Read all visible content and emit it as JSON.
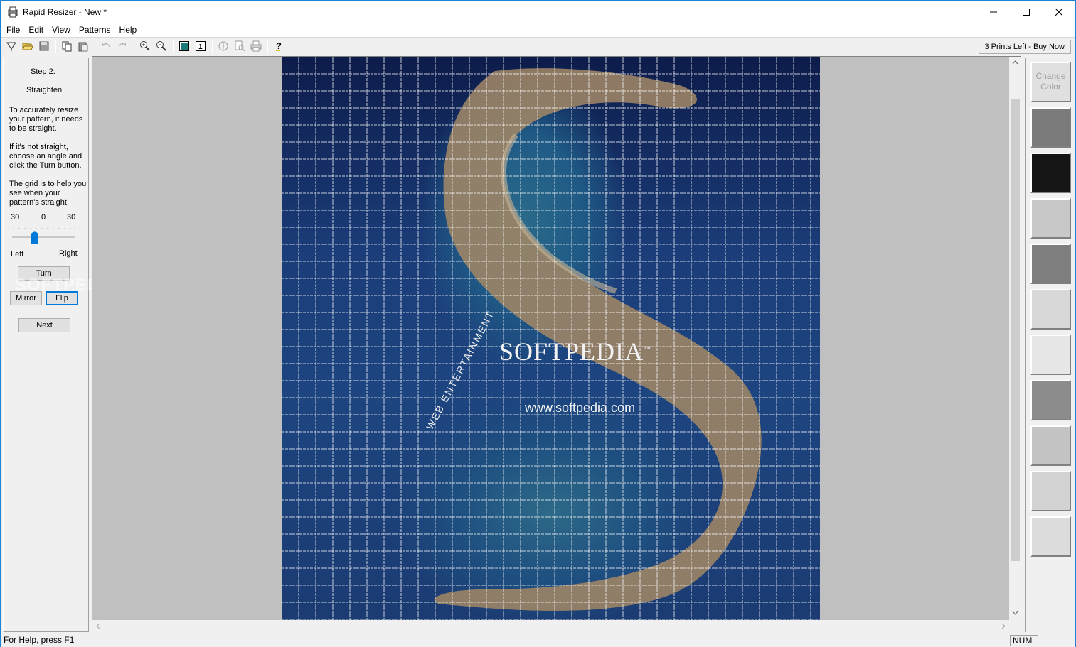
{
  "window": {
    "title": "Rapid Resizer - New *"
  },
  "menu": [
    "File",
    "Edit",
    "View",
    "Patterns",
    "Help"
  ],
  "toolbar": {
    "buttons": [
      "new-icon",
      "open-icon",
      "save-icon",
      "copy-icon",
      "paste-icon",
      "undo-icon",
      "redo-icon",
      "zoom-in-icon",
      "zoom-out-icon",
      "fit-page-icon",
      "actual-size-icon",
      "info-icon",
      "print-preview-icon",
      "print-icon",
      "help-icon"
    ],
    "buy_label": "3 Prints Left - Buy Now"
  },
  "left_panel": {
    "step": "Step 2:",
    "heading": "Straighten",
    "para1": "To accurately resize your pattern, it needs to be straight.",
    "para2": "If it's not straight, choose an angle and click the Turn button.",
    "para3": "The grid is to help you see when your pattern's straight.",
    "slider": {
      "min_label": "30",
      "mid_label": "0",
      "max_label": "30",
      "left_label": "Left",
      "right_label": "Right",
      "value": 0.32
    },
    "turn_label": "Turn",
    "mirror_label": "Mirror",
    "flip_label": "Flip",
    "next_label": "Next"
  },
  "canvas": {
    "watermark_title": "SOFTPEDIA",
    "watermark_tm": "™",
    "watermark_url": "www.softpedia.com",
    "watermark_side": "WEB ENTERTAINMENT",
    "side_watermark": "SOFTPEDIA"
  },
  "right_panel": {
    "change_color_label": "Change Color",
    "swatches": [
      "#7a7a7a",
      "#161616",
      "#c8c8c8",
      "#7e7e7e",
      "#d8d8d8",
      "#e6e6e6",
      "#8c8c8c",
      "#c4c4c4",
      "#d2d2d2",
      "#dcdcdc"
    ]
  },
  "status": {
    "help_text": "For Help, press F1",
    "num": "NUM"
  }
}
